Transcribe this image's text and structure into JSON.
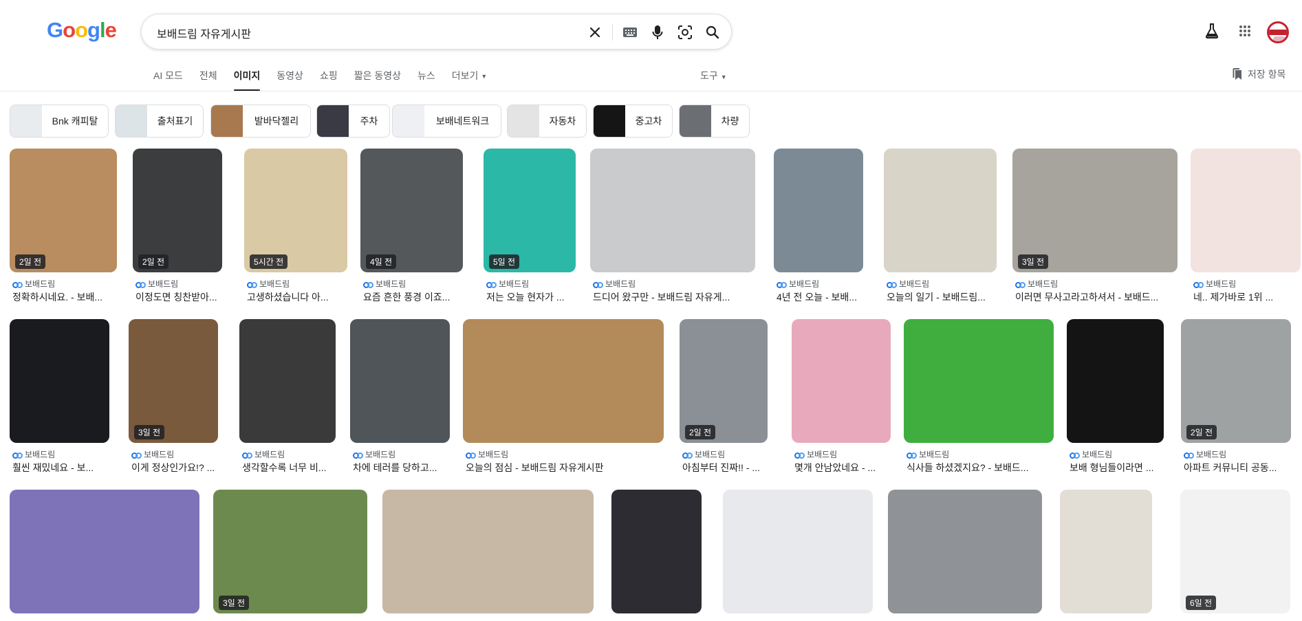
{
  "logo": {
    "letters": [
      "G",
      "o",
      "o",
      "g",
      "l",
      "e"
    ],
    "colors": [
      "#4285F4",
      "#EA4335",
      "#FBBC05",
      "#4285F4",
      "#34A853",
      "#EA4335"
    ]
  },
  "search": {
    "query": "보배드림 자유게시판"
  },
  "tabs": [
    {
      "label": "AI 모드"
    },
    {
      "label": "전체"
    },
    {
      "label": "이미지",
      "active": true
    },
    {
      "label": "동영상"
    },
    {
      "label": "쇼핑"
    },
    {
      "label": "짧은 동영상"
    },
    {
      "label": "뉴스"
    },
    {
      "label": "더보기"
    }
  ],
  "tools_label": "도구",
  "saved_label": "저장 항목",
  "chips": [
    {
      "label": "Bnk 캐피탈",
      "color": "#e9ecef"
    },
    {
      "label": "출처표기",
      "color": "#dde4e8"
    },
    {
      "label": "발바닥젤리",
      "color": "#a8794e"
    },
    {
      "label": "주차",
      "color": "#3a3a44"
    },
    {
      "label": "보배네트워크",
      "color": "#eef0f3"
    },
    {
      "label": "자동차",
      "color": "#e4e4e4"
    },
    {
      "label": "중고차",
      "color": "#151515"
    },
    {
      "label": "차량",
      "color": "#6b6e72"
    }
  ],
  "source_name": "보배드림",
  "rows": [
    [
      {
        "badge": "2일 전",
        "title": "정확하시네요. - 보배...",
        "color": "#b98d5f"
      },
      {
        "badge": "2일 전",
        "title": "이정도면 칭찬받아...",
        "color": "#3b3d3f"
      },
      {
        "badge": "5시간 전",
        "title": "고생하셨습니다 아...",
        "color": "#d9c9a4"
      },
      {
        "badge": "4일 전",
        "title": "요즘 흔한 풍경 이죠...",
        "color": "#55585b"
      },
      {
        "badge": "5일 전",
        "title": "저는 오늘 현자가 ...",
        "color": "#2bb8a6"
      },
      {
        "badge": "",
        "title": "드디어 왔구만 - 보배드림 자유게...",
        "color": "#c9cbcc"
      },
      {
        "badge": "",
        "title": "4년 전 오늘 - 보배...",
        "color": "#7c8a95"
      },
      {
        "badge": "",
        "title": "오늘의 일기 - 보배드림...",
        "color": "#d8d4c8"
      },
      {
        "badge": "3일 전",
        "title": "이러면 무사고라고하셔서 - 보배드...",
        "color": "#a7a49d"
      },
      {
        "badge": "",
        "title": "네.. 제가바로 1위 ...",
        "color": "#f3e3e0"
      }
    ],
    [
      {
        "badge": "",
        "title": "훨씬 재밌네요 - 보...",
        "color": "#1a1b1f"
      },
      {
        "badge": "3일 전",
        "title": "이게 정상인가요!? ...",
        "color": "#7a5a3c"
      },
      {
        "badge": "",
        "title": "생각할수록 너무 비...",
        "color": "#3a3a3a"
      },
      {
        "badge": "",
        "title": "차에 테러를 당하고...",
        "color": "#4f5559"
      },
      {
        "badge": "",
        "title": "오늘의 점심 - 보배드림 자유게시판",
        "color": "#b38a5a"
      },
      {
        "badge": "2일 전",
        "title": "아침부터 진짜!! - ...",
        "color": "#8b9096"
      },
      {
        "badge": "",
        "title": "몇개 안남았네요 - ...",
        "color": "#e9a9bd"
      },
      {
        "badge": "",
        "title": "식사들 하셨겠지요? - 보배드...",
        "color": "#3fae3f"
      },
      {
        "badge": "",
        "title": "보배 형님들이라면 ...",
        "color": "#141414"
      },
      {
        "badge": "2일 전",
        "title": "아파트 커뮤니티 공동...",
        "color": "#9fa2a3"
      }
    ],
    [
      {
        "badge": "",
        "color": "#7e73b8"
      },
      {
        "badge": "3일 전",
        "color": "#6d8a4e"
      },
      {
        "badge": "",
        "color": "#c7b8a5"
      },
      {
        "badge": "",
        "color": "#2c2c32"
      },
      {
        "badge": "",
        "color": "#e8e9ec"
      },
      {
        "badge": "",
        "color": "#8f9296"
      },
      {
        "badge": "",
        "color": "#e2ded6"
      },
      {
        "badge": "6일 전",
        "color": "#f2f2f2"
      }
    ]
  ]
}
